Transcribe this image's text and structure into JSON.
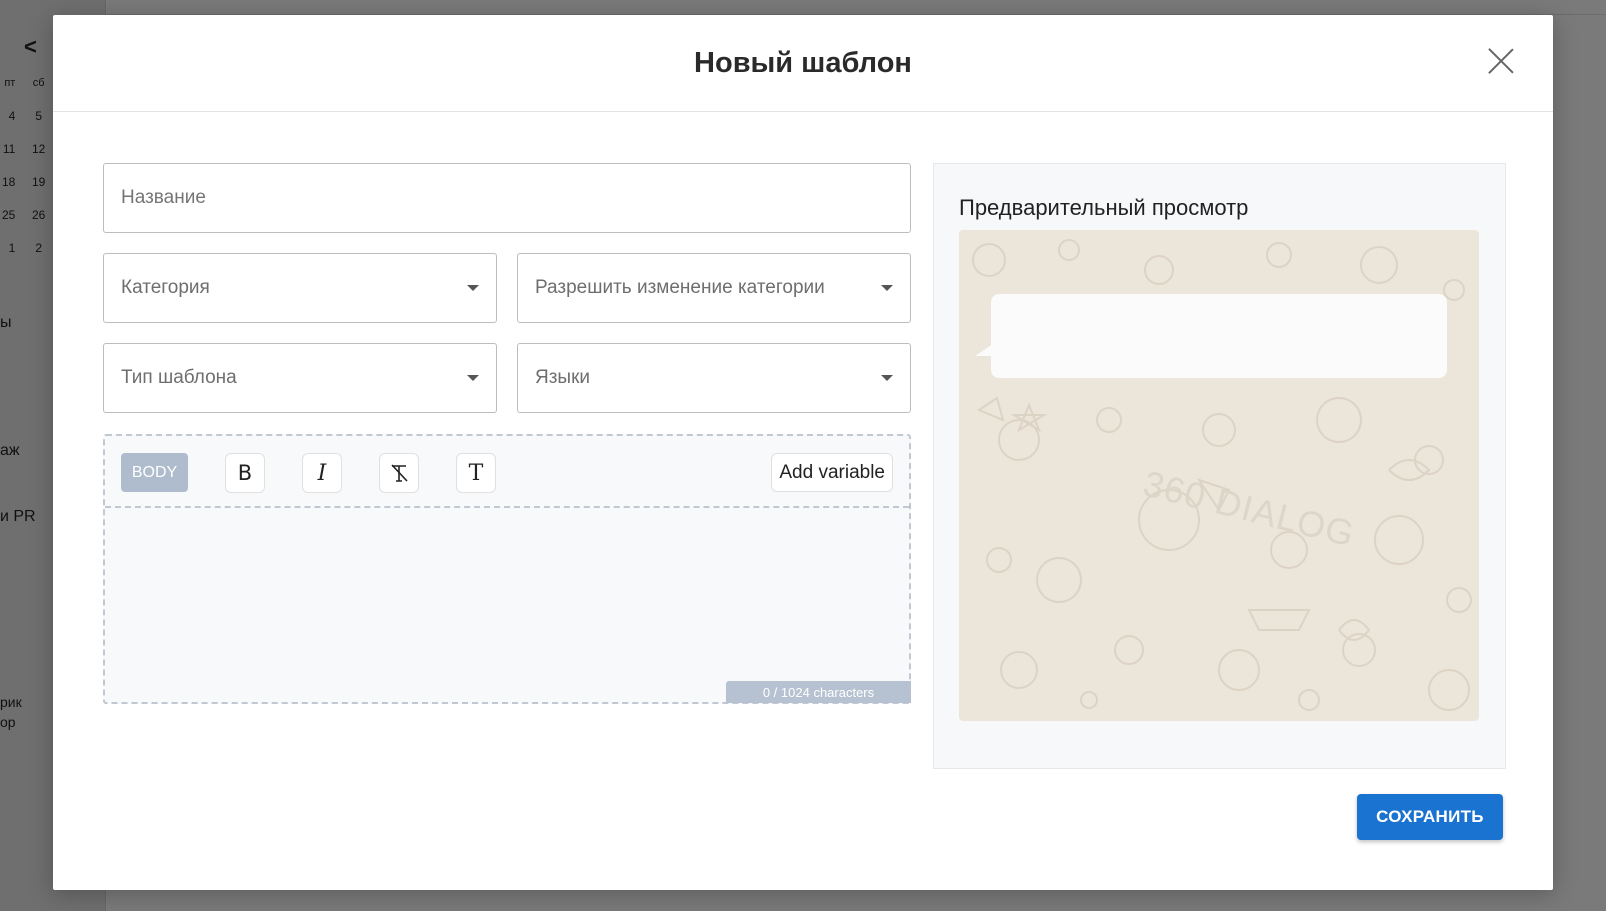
{
  "background": {
    "back_arrow": "<",
    "calendar": {
      "headers": [
        "пт",
        "сб"
      ],
      "rows": [
        [
          "4",
          "5"
        ],
        [
          "11",
          "12"
        ],
        [
          "18",
          "19"
        ],
        [
          "25",
          "26"
        ],
        [
          "1",
          "2"
        ]
      ]
    },
    "sidebar_fragments": [
      "ы",
      "аж",
      "и PR",
      "рик",
      "ор"
    ]
  },
  "modal": {
    "title": "Новый шаблон",
    "close_icon": "close-icon",
    "form": {
      "name_placeholder": "Название",
      "category_placeholder": "Категория",
      "allow_category_change_placeholder": "Разрешить изменение категории",
      "template_type_placeholder": "Тип шаблона",
      "languages_placeholder": "Языки"
    },
    "editor": {
      "section_badge": "BODY",
      "bold_glyph": "B",
      "italic_glyph": "I",
      "clear_format_glyph": "T̸",
      "text_glyph": "T",
      "add_variable_label": "Add variable",
      "char_count": "0 / 1024 characters"
    },
    "preview": {
      "title": "Предварительный просмотр",
      "watermark": "360 DIALOG"
    },
    "save_label": "СОХРАНИТЬ"
  }
}
